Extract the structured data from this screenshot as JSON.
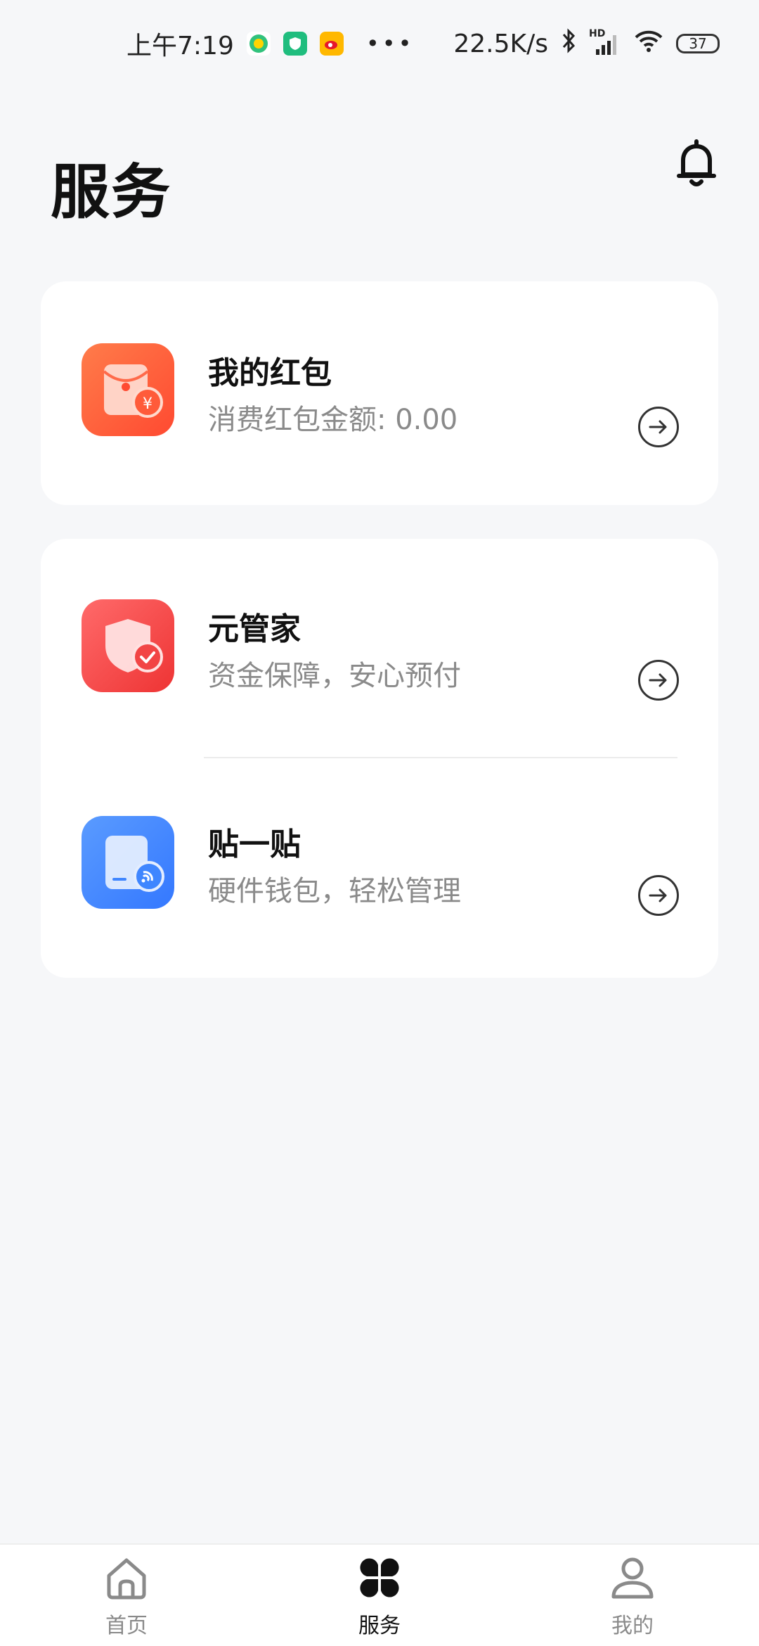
{
  "status_bar": {
    "time": "上午7:19",
    "network_speed": "22.5K/s",
    "network_type": "HD",
    "battery": "37",
    "icons": [
      "qq-music-icon",
      "shield-app-icon",
      "weibo-icon",
      "more-dots-icon",
      "bluetooth-icon",
      "signal-icon",
      "wifi-icon",
      "battery-icon"
    ]
  },
  "header": {
    "title": "服务",
    "bell_icon": "bell-icon"
  },
  "cards": [
    {
      "items": [
        {
          "title": "我的红包",
          "subtitle": "消费红包金额: 0.00",
          "icon": "red-envelope-icon",
          "color": "#ff5b3a"
        }
      ]
    },
    {
      "items": [
        {
          "title": "元管家",
          "subtitle": "资金保障，安心预付",
          "icon": "shield-check-icon",
          "color": "#f24545"
        },
        {
          "title": "贴一贴",
          "subtitle": "硬件钱包，轻松管理",
          "icon": "nfc-card-icon",
          "color": "#3f86ff"
        }
      ]
    }
  ],
  "bottom_nav": {
    "items": [
      {
        "label": "首页",
        "icon": "home-icon",
        "active": false
      },
      {
        "label": "服务",
        "icon": "services-grid-icon",
        "active": true
      },
      {
        "label": "我的",
        "icon": "user-icon",
        "active": false
      }
    ]
  }
}
